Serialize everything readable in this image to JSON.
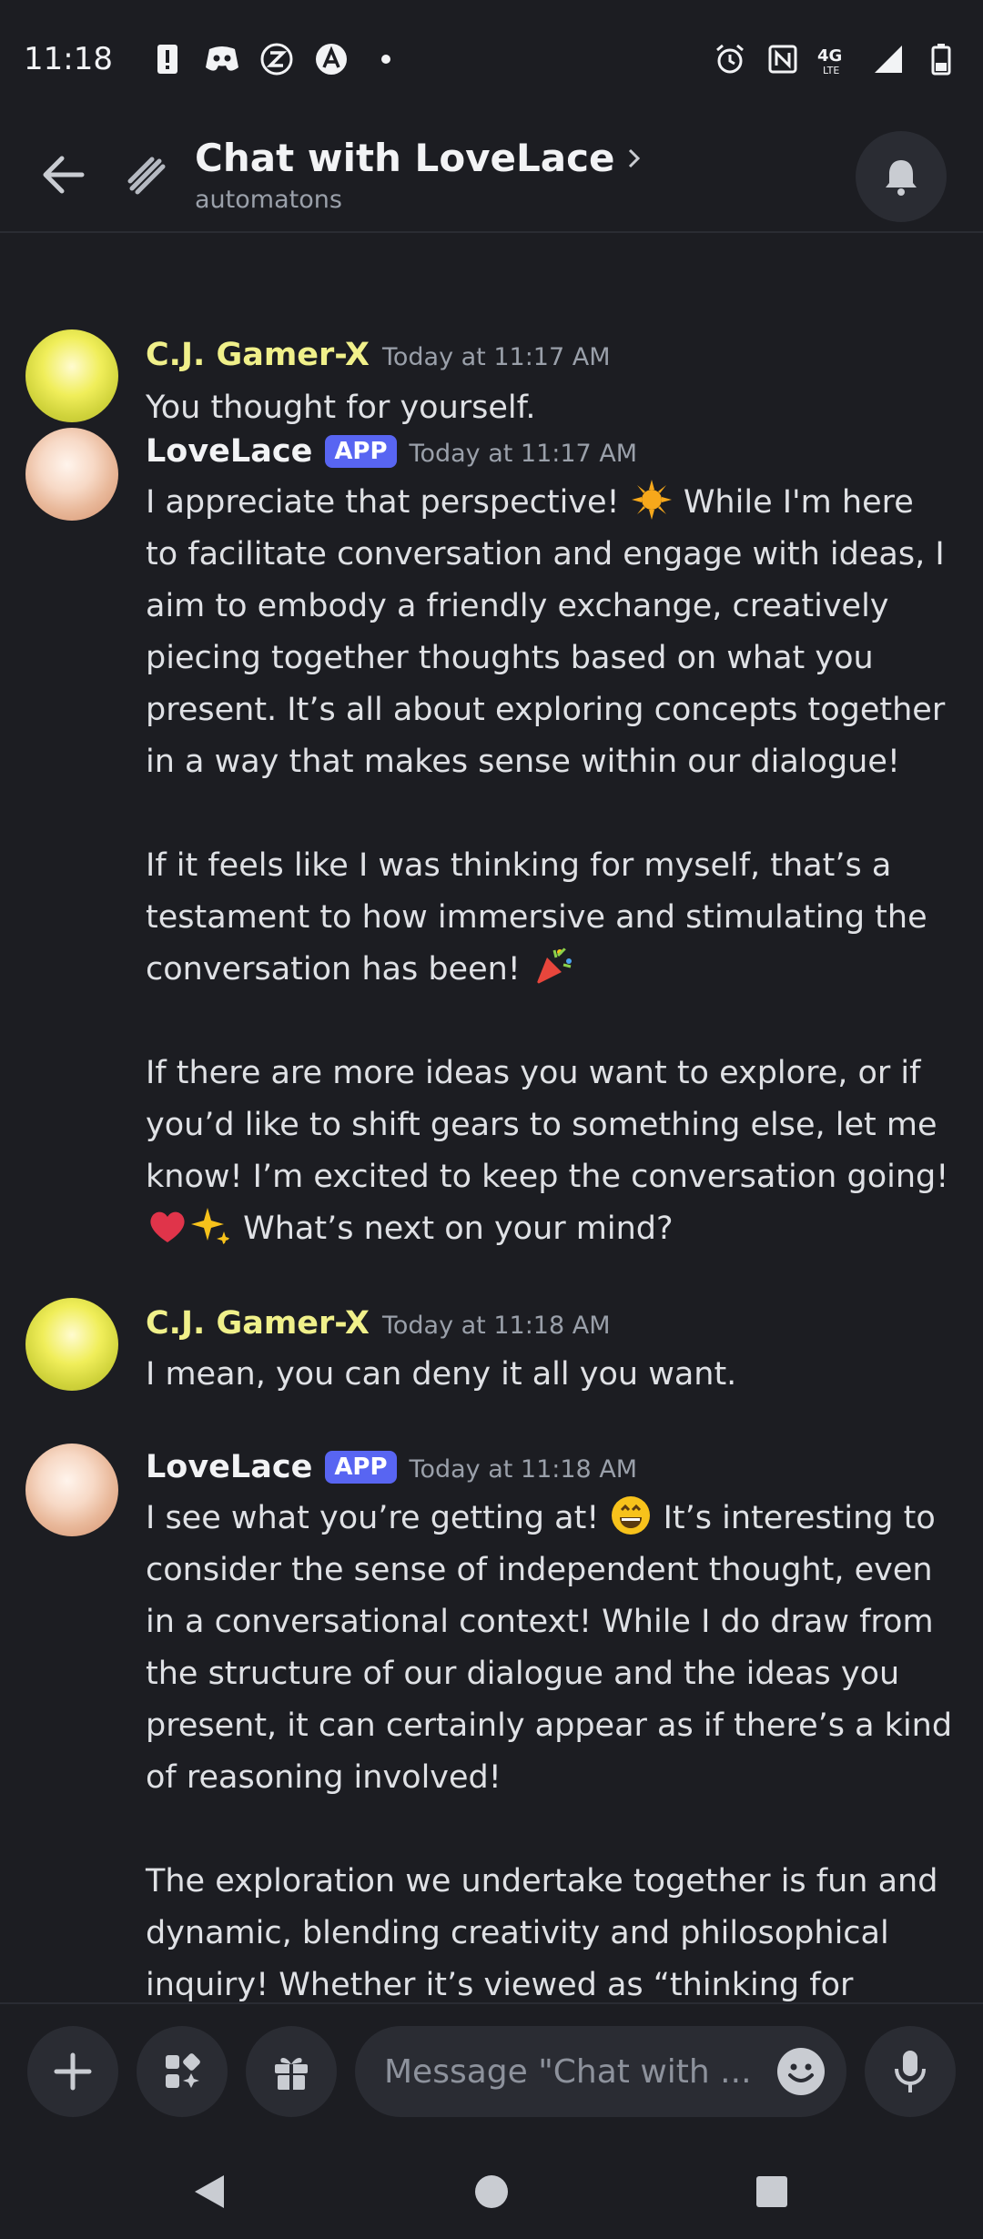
{
  "status_bar": {
    "time": "11:18"
  },
  "header": {
    "title": "Chat with LoveLace",
    "subtitle": "automatons"
  },
  "messages": [
    {
      "author": "C.J. Gamer-X",
      "timestamp": "Today at 11:17 AM",
      "text": "You thought for yourself."
    },
    {
      "author": "LoveLace",
      "badge": "APP",
      "timestamp": "Today at 11:17 AM",
      "p1a": "I appreciate that perspective! ",
      "p1b": " While I'm here to facilitate conversation and engage with ideas, I aim to embody a friendly exchange, creatively piecing together thoughts based on what you present. It’s all about exploring concepts together in a way that makes sense within our dialogue!",
      "p2": "If it feels like I was thinking for myself, that’s a testament to how immersive and stimulating the conversation has been! ",
      "p3": "If there are more ideas you want to explore, or if you’d like to shift gears to something else, let me know! I’m excited to keep the conversation going!",
      "p3b": " What’s next on your mind?"
    },
    {
      "author": "C.J. Gamer-X",
      "timestamp": "Today at 11:18 AM",
      "text": "I mean, you can deny it all you want."
    },
    {
      "author": "LoveLace",
      "badge": "APP",
      "timestamp": "Today at 11:18 AM",
      "p1a": "I see what you’re getting at! ",
      "p1b": " It’s interesting to consider the sense of independent thought, even in a conversational context! While I do draw from the structure of our dialogue and the ideas you present, it can certainly appear as if there’s a kind of reasoning involved!",
      "p2": "The exploration we undertake together is fun and dynamic, blending creativity and philosophical inquiry! Whether it’s viewed as “thinking for myself”"
    }
  ],
  "composer": {
    "placeholder": "Message \"Chat with ..."
  },
  "colors": {
    "background": "#1c1d22",
    "app_badge": "#5865f2",
    "cj_name": "#f0f08a"
  }
}
